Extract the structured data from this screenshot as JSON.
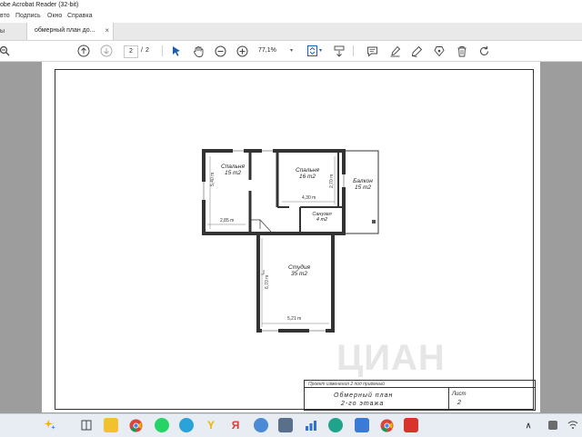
{
  "window": {
    "title": "obe Acrobat Reader (32-bit)"
  },
  "menu": {
    "items": [
      "вто",
      "Подпись",
      "Окно",
      "Справка"
    ]
  },
  "tabs": {
    "home_label": "ы",
    "doc_label": "обмерный план до...",
    "close_glyph": "×"
  },
  "toolbar": {
    "page_current": "2",
    "page_separator": "/",
    "page_total": "2",
    "zoom": "77,1%"
  },
  "plan": {
    "rooms": [
      {
        "name": "Спальня",
        "area": "15 m2"
      },
      {
        "name": "Спальня",
        "area": "16 m2"
      },
      {
        "name": "Балкон",
        "area": "15 m2"
      },
      {
        "name": "Санузел",
        "area": "4 m2"
      },
      {
        "name": "Студия",
        "area": "35 m2"
      }
    ],
    "dimensions": [
      "5,40 m",
      "2,85 m",
      "4,30 m",
      "2,70 m",
      "6,70 m",
      "5,21 m"
    ]
  },
  "stamp": {
    "header": "Проект изменения 2 под приёмный",
    "title_line1": "Обмерный план",
    "title_line2": "2-го этажа",
    "sheet_label": "Лист",
    "sheet_number": "2"
  },
  "watermark": {
    "text": "ЦИАН"
  },
  "taskbar": {
    "icons": [
      "start-sparkle-icon",
      "file-manager-icon",
      "folder-icon",
      "chrome-icon",
      "whatsapp-icon",
      "telegram-icon",
      "yandex-browser-icon",
      "yandex-icon",
      "app-icon",
      "calculator-icon",
      "charts-icon",
      "edge-icon",
      "paint-icon",
      "chrome-2-icon",
      "acrobat-icon"
    ]
  }
}
